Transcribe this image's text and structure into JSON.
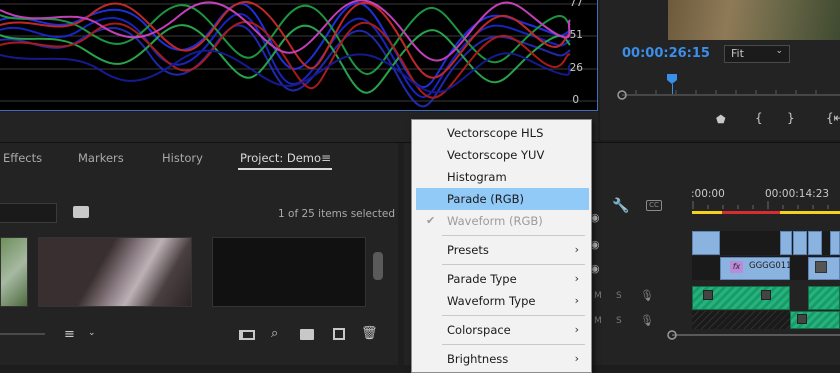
{
  "scope": {
    "ticks": [
      "77",
      "51",
      "26",
      "0"
    ]
  },
  "program": {
    "timecode": "00:00:26:15",
    "fit_label": "Fit"
  },
  "project_panel": {
    "tabs": [
      {
        "label": "Effects",
        "active": false
      },
      {
        "label": "Markers",
        "active": false
      },
      {
        "label": "History",
        "active": false
      },
      {
        "label": "Project: Demo",
        "active": true
      }
    ],
    "items_count": "1 of 25 items selected"
  },
  "context_menu": {
    "items": [
      {
        "label": "Vectorscope HLS"
      },
      {
        "label": "Vectorscope YUV"
      },
      {
        "label": "Histogram"
      },
      {
        "label": "Parade (RGB)",
        "highlighted": true
      },
      {
        "label": "Waveform (RGB)",
        "disabled": true,
        "checked": true
      },
      {
        "label": "Presets",
        "submenu": true
      },
      {
        "label": "Parade Type",
        "submenu": true
      },
      {
        "label": "Waveform Type",
        "submenu": true
      },
      {
        "label": "Colorspace",
        "submenu": true
      },
      {
        "label": "Brightness",
        "submenu": true
      }
    ]
  },
  "timeline": {
    "ruler_labels": [
      ":00:00",
      "00:00:14:23"
    ],
    "clip_label": "GGGG011",
    "fx_label": "fx",
    "track_labels": [
      "M",
      "S",
      "M",
      "S"
    ]
  },
  "colors": {
    "accent_blue": "#3b8eea",
    "menu_highlight": "#91c9f7",
    "audio_clip": "#23b37c",
    "video_clip": "#8bb3e0",
    "work_area_yellow": "#f2d21b"
  }
}
